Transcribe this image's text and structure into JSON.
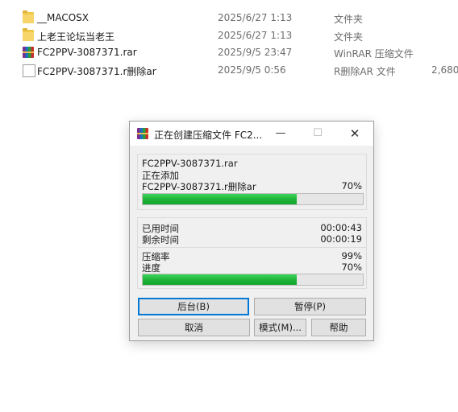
{
  "files": [
    {
      "name": "__MACOSX",
      "date": "2025/6/27 1:13",
      "type": "文件夹",
      "size": "",
      "icon": "folder-icon"
    },
    {
      "name": "上老王论坛当老王",
      "date": "2025/6/27 1:13",
      "type": "文件夹",
      "size": "",
      "icon": "folder-icon"
    },
    {
      "name": "FC2PPV-3087371.rar",
      "date": "2025/9/5 23:47",
      "type": "WinRAR 压缩文件",
      "size": "",
      "icon": "rar-icon"
    },
    {
      "name": "FC2PPV-3087371.r删除ar",
      "date": "2025/9/5 0:56",
      "type": "R删除AR 文件",
      "size": "2,680",
      "icon": "document-icon"
    }
  ],
  "dialog": {
    "title": "正在创建压缩文件 FC2...",
    "min_glyph": "—",
    "max_glyph": "☐",
    "close_glyph": "✕",
    "archive_name": "FC2PPV-3087371.rar",
    "action": "正在添加",
    "current_file": "FC2PPV-3087371.r删除ar",
    "file_percent": "70%",
    "file_progress": 0.7,
    "elapsed_label": "已用时间",
    "elapsed_value": "00:00:43",
    "remaining_label": "剩余时间",
    "remaining_value": "00:00:19",
    "ratio_label": "压缩率",
    "ratio_value": "99%",
    "progress_label": "进度",
    "progress_value": "70%",
    "total_progress": 0.7,
    "buttons": {
      "background": "后台(B)",
      "pause": "暂停(P)",
      "cancel": "取消",
      "mode": "模式(M)...",
      "help": "帮助"
    },
    "progress_color": "#1fb43a",
    "focus_color": "#0078d7"
  }
}
